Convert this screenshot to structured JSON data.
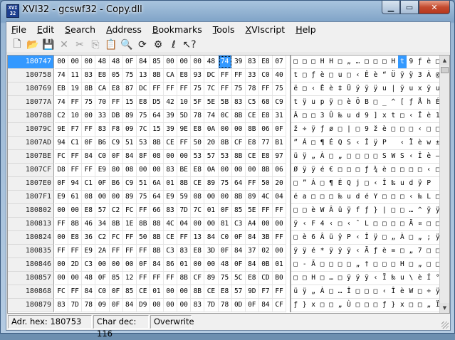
{
  "window": {
    "title": "XVI32 - gcswf32 - Copy.dll"
  },
  "menu": [
    {
      "u": "F",
      "rest": "ile"
    },
    {
      "u": "E",
      "rest": "dit"
    },
    {
      "u": "S",
      "rest": "earch"
    },
    {
      "u": "A",
      "rest": "ddress"
    },
    {
      "u": "B",
      "rest": "ookmarks"
    },
    {
      "u": "T",
      "rest": "ools"
    },
    {
      "u": "X",
      "rest": "VIscript"
    },
    {
      "u": "H",
      "rest": "elp"
    }
  ],
  "toolbar": [
    {
      "name": "new-file-icon",
      "glyph": "🗋"
    },
    {
      "name": "open-file-icon",
      "glyph": "📂"
    },
    {
      "name": "save-icon",
      "glyph": "💾"
    },
    {
      "name": "delete-icon",
      "glyph": "✕",
      "dim": true
    },
    {
      "name": "cut-icon",
      "glyph": "✂",
      "dim": true
    },
    {
      "name": "copy-icon",
      "glyph": "⎘",
      "dim": true
    },
    {
      "name": "paste-icon",
      "glyph": "📋"
    },
    {
      "name": "find-icon",
      "glyph": "🔍"
    },
    {
      "name": "replace-icon",
      "glyph": "⟳"
    },
    {
      "name": "properties-icon",
      "glyph": "⚙"
    },
    {
      "name": "xviscript-icon",
      "glyph": "ℓ"
    },
    {
      "name": "context-help-icon",
      "glyph": "↖?"
    }
  ],
  "selected": {
    "row": 0,
    "col": 13
  },
  "rows": [
    {
      "addr": "180747",
      "hex": [
        "00",
        "00",
        "00",
        "48",
        "48",
        "0F",
        "84",
        "85",
        "00",
        "00",
        "00",
        "48",
        "74",
        "39",
        "83",
        "E8",
        "07"
      ],
      "ascii": [
        "□",
        "□",
        "□",
        "H",
        "H",
        "□",
        "„",
        "…",
        "□",
        "□",
        "□",
        "H",
        "t",
        "9",
        "ƒ",
        "è",
        "□"
      ]
    },
    {
      "addr": "180758",
      "hex": [
        "74",
        "11",
        "83",
        "E8",
        "05",
        "75",
        "13",
        "8B",
        "CA",
        "E8",
        "93",
        "DC",
        "FF",
        "FF",
        "33",
        "C0",
        "40"
      ],
      "ascii": [
        "t",
        "□",
        "ƒ",
        "è",
        "□",
        "u",
        "□",
        "‹",
        "Ê",
        "è",
        "“",
        "Ü",
        "ÿ",
        "ÿ",
        "3",
        "À",
        "@"
      ]
    },
    {
      "addr": "180769",
      "hex": [
        "EB",
        "19",
        "8B",
        "CA",
        "E8",
        "87",
        "DC",
        "FF",
        "FF",
        "FF",
        "75",
        "7C",
        "FF",
        "75",
        "78",
        "FF",
        "75"
      ],
      "ascii": [
        "ë",
        "□",
        "‹",
        "Ê",
        "è",
        "‡",
        "Ü",
        "ÿ",
        "ÿ",
        "ÿ",
        "u",
        "|",
        "ÿ",
        "u",
        "x",
        "ÿ",
        "u"
      ]
    },
    {
      "addr": "18077A",
      "hex": [
        "74",
        "FF",
        "75",
        "70",
        "FF",
        "15",
        "E8",
        "D5",
        "42",
        "10",
        "5F",
        "5E",
        "5B",
        "83",
        "C5",
        "68",
        "C9"
      ],
      "ascii": [
        "t",
        "ÿ",
        "u",
        "p",
        "ÿ",
        "□",
        "è",
        "Õ",
        "B",
        "□",
        "_",
        "^",
        "[",
        "ƒ",
        "Å",
        "h",
        "É"
      ]
    },
    {
      "addr": "18078B",
      "hex": [
        "C2",
        "10",
        "00",
        "33",
        "DB",
        "89",
        "75",
        "64",
        "39",
        "5D",
        "78",
        "74",
        "0C",
        "8B",
        "CE",
        "E8",
        "31"
      ],
      "ascii": [
        "Â",
        "□",
        "□",
        "3",
        "Û",
        "‰",
        "u",
        "d",
        "9",
        "]",
        "x",
        "t",
        "□",
        "‹",
        "Î",
        "è",
        "1"
      ]
    },
    {
      "addr": "18079C",
      "hex": [
        "9E",
        "F7",
        "FF",
        "83",
        "F8",
        "09",
        "7C",
        "15",
        "39",
        "9E",
        "E8",
        "0A",
        "00",
        "00",
        "8B",
        "06",
        "0F"
      ],
      "ascii": [
        "ž",
        "÷",
        "ÿ",
        "ƒ",
        "ø",
        "□",
        "|",
        "□",
        "9",
        "ž",
        "è",
        "□",
        "□",
        "□",
        "‹",
        "□",
        "□"
      ]
    },
    {
      "addr": "1807AD",
      "hex": [
        "94",
        "C1",
        "0F",
        "B6",
        "C9",
        "51",
        "53",
        "8B",
        "CE",
        "FF",
        "50",
        "20",
        "8B",
        "CF",
        "E8",
        "77",
        "B1"
      ],
      "ascii": [
        "”",
        "Á",
        "□",
        "¶",
        "É",
        "Q",
        "S",
        "‹",
        "Î",
        "ÿ",
        "P",
        " ",
        "‹",
        "Ï",
        "è",
        "w",
        "±"
      ]
    },
    {
      "addr": "1807BE",
      "hex": [
        "FC",
        "FF",
        "84",
        "C0",
        "0F",
        "84",
        "8F",
        "08",
        "00",
        "00",
        "53",
        "57",
        "53",
        "8B",
        "CE",
        "E8",
        "97"
      ],
      "ascii": [
        "ü",
        "ÿ",
        "„",
        "À",
        "□",
        "„",
        "□",
        "□",
        "□",
        "□",
        "S",
        "W",
        "S",
        "‹",
        "Î",
        "è",
        "—"
      ]
    },
    {
      "addr": "1807CF",
      "hex": [
        "D8",
        "FF",
        "FF",
        "E9",
        "80",
        "08",
        "00",
        "00",
        "83",
        "BE",
        "E8",
        "0A",
        "00",
        "00",
        "00",
        "8B",
        "06"
      ],
      "ascii": [
        "Ø",
        "ÿ",
        "ÿ",
        "é",
        "€",
        "□",
        "□",
        "□",
        "ƒ",
        "¾",
        "è",
        "□",
        "□",
        "□",
        "□",
        "‹",
        "□"
      ]
    },
    {
      "addr": "1807E0",
      "hex": [
        "0F",
        "94",
        "C1",
        "0F",
        "B6",
        "C9",
        "51",
        "6A",
        "01",
        "8B",
        "CE",
        "89",
        "75",
        "64",
        "FF",
        "50",
        "20"
      ],
      "ascii": [
        "□",
        "”",
        "Á",
        "□",
        "¶",
        "É",
        "Q",
        "j",
        "□",
        "‹",
        "Î",
        "‰",
        "u",
        "d",
        "ÿ",
        "P",
        " "
      ]
    },
    {
      "addr": "1807F1",
      "hex": [
        "E9",
        "61",
        "08",
        "00",
        "00",
        "89",
        "75",
        "64",
        "E9",
        "59",
        "08",
        "00",
        "00",
        "8B",
        "89",
        "4C",
        "04"
      ],
      "ascii": [
        "é",
        "a",
        "□",
        "□",
        "□",
        "‰",
        "u",
        "d",
        "é",
        "Y",
        "□",
        "□",
        "□",
        "‹",
        "‰",
        "L",
        "□"
      ]
    },
    {
      "addr": "180802",
      "hex": [
        "00",
        "00",
        "E8",
        "57",
        "C2",
        "FC",
        "FF",
        "66",
        "83",
        "7D",
        "7C",
        "01",
        "0F",
        "85",
        "5E",
        "FF",
        "FF"
      ],
      "ascii": [
        "□",
        "□",
        "è",
        "W",
        "Â",
        "ü",
        "ÿ",
        "f",
        "ƒ",
        "}",
        "|",
        "□",
        "□",
        "…",
        "^",
        "ÿ",
        "ÿ"
      ]
    },
    {
      "addr": "180813",
      "hex": [
        "FF",
        "8B",
        "46",
        "34",
        "8B",
        "1E",
        "8B",
        "88",
        "4C",
        "04",
        "00",
        "00",
        "81",
        "C3",
        "A4",
        "00",
        "00"
      ],
      "ascii": [
        "ÿ",
        "‹",
        "F",
        "4",
        "‹",
        "□",
        "‹",
        "ˆ",
        "L",
        "□",
        "□",
        "□",
        "□",
        "Ã",
        "¤",
        "□",
        "□"
      ]
    },
    {
      "addr": "180824",
      "hex": [
        "00",
        "E8",
        "36",
        "C2",
        "FC",
        "FF",
        "50",
        "8B",
        "CE",
        "FF",
        "13",
        "84",
        "C0",
        "0F",
        "84",
        "3B",
        "FF"
      ],
      "ascii": [
        "□",
        "è",
        "6",
        "Â",
        "ü",
        "ÿ",
        "P",
        "‹",
        "Î",
        "ÿ",
        "□",
        "„",
        "À",
        "□",
        "„",
        ";",
        "ÿ"
      ]
    },
    {
      "addr": "180835",
      "hex": [
        "FF",
        "FF",
        "E9",
        "2A",
        "FF",
        "FF",
        "FF",
        "8B",
        "C3",
        "83",
        "E8",
        "3D",
        "0F",
        "84",
        "37",
        "02",
        "00"
      ],
      "ascii": [
        "ÿ",
        "ÿ",
        "é",
        "*",
        "ÿ",
        "ÿ",
        "ÿ",
        "‹",
        "Ã",
        "ƒ",
        "è",
        "=",
        "□",
        "„",
        "7",
        "□",
        "□"
      ]
    },
    {
      "addr": "180846",
      "hex": [
        "00",
        "2D",
        "C3",
        "00",
        "00",
        "00",
        "0F",
        "84",
        "86",
        "01",
        "00",
        "00",
        "48",
        "0F",
        "84",
        "0B",
        "01"
      ],
      "ascii": [
        "□",
        "-",
        "Ã",
        "□",
        "□",
        "□",
        "□",
        "„",
        "†",
        "□",
        "□",
        "□",
        "H",
        "□",
        "„",
        "□",
        "□"
      ]
    },
    {
      "addr": "180857",
      "hex": [
        "00",
        "00",
        "48",
        "0F",
        "85",
        "12",
        "FF",
        "FF",
        "FF",
        "8B",
        "CF",
        "89",
        "75",
        "5C",
        "E8",
        "CD",
        "B0"
      ],
      "ascii": [
        "□",
        "□",
        "H",
        "□",
        "…",
        "□",
        "ÿ",
        "ÿ",
        "ÿ",
        "‹",
        "Ï",
        "‰",
        "u",
        "\\",
        "è",
        "Í",
        "°"
      ]
    },
    {
      "addr": "180868",
      "hex": [
        "FC",
        "FF",
        "84",
        "C0",
        "0F",
        "85",
        "CE",
        "01",
        "00",
        "00",
        "8B",
        "CE",
        "E8",
        "57",
        "9D",
        "F7",
        "FF"
      ],
      "ascii": [
        "ü",
        "ÿ",
        "„",
        "À",
        "□",
        "…",
        "Î",
        "□",
        "□",
        "□",
        "‹",
        "Î",
        "è",
        "W",
        "□",
        "÷",
        "ÿ"
      ]
    },
    {
      "addr": "180879",
      "hex": [
        "83",
        "7D",
        "78",
        "09",
        "0F",
        "84",
        "D9",
        "00",
        "00",
        "00",
        "83",
        "7D",
        "78",
        "0D",
        "0F",
        "84",
        "CF"
      ],
      "ascii": [
        "ƒ",
        "}",
        "x",
        "□",
        "□",
        "„",
        "Ù",
        "□",
        "□",
        "□",
        "ƒ",
        "}",
        "x",
        "□",
        "□",
        "„",
        "Ï"
      ]
    }
  ],
  "status": {
    "adr": "Adr. hex: 180753",
    "chr": "Char dec: 116",
    "mode": "Overwrite"
  }
}
